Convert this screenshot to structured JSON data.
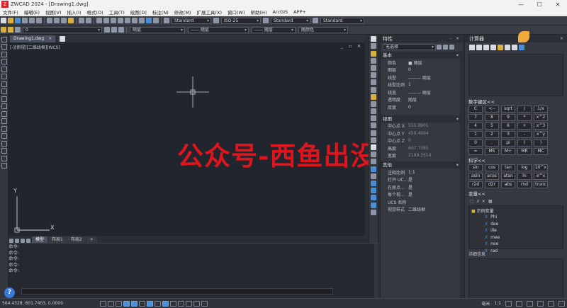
{
  "titlebar": {
    "logo": "Z",
    "title": "ZWCAD 2024 - [Drawing1.dwg]",
    "minimize": "—",
    "maximize": "☐",
    "close": "✕"
  },
  "menu": [
    "文件(F)",
    "编辑(E)",
    "视图(V)",
    "插入(I)",
    "格式(O)",
    "工具(T)",
    "绘图(D)",
    "标注(N)",
    "修改(M)",
    "扩展工具(X)",
    "窗口(W)",
    "帮助(H)",
    "ArcGIS",
    "APP+"
  ],
  "toolbar1": {
    "text_style": "Standard",
    "dim_style": "ISO-25",
    "table_style": "Standard",
    "multileader_style": "Standard"
  },
  "toolbar2": {
    "layer": "0",
    "color": "随层",
    "linetype": "—— 随层",
    "lineweight": "—— 随层",
    "plotstyle": "随颜色"
  },
  "doc": {
    "tab_label": "Drawing1.dwg",
    "viewport_label": "[-][俯视][二维线框][WCS]",
    "viewport_controls": "_ ▫ ✕"
  },
  "ucs": {
    "y": "Y",
    "x": "X"
  },
  "watermark": "公众号-西鱼出没",
  "layout_tabs": [
    "模型",
    "布局1",
    "布局2",
    "+"
  ],
  "command": {
    "lines": [
      "命令:",
      "命令:",
      "命令:",
      "命令:",
      "命令:"
    ]
  },
  "status": {
    "coords": "564.4328, 601.7403, 0.0000",
    "scale": "1:1",
    "units": "毫米"
  },
  "properties": {
    "title": "特性",
    "selection": "无选择",
    "sections": [
      {
        "name": "基本",
        "rows": [
          {
            "k": "颜色",
            "v": "■ 随层"
          },
          {
            "k": "图层",
            "v": "0"
          },
          {
            "k": "线型",
            "v": "——— 随层"
          },
          {
            "k": "线型比例",
            "v": "1"
          },
          {
            "k": "线宽",
            "v": "——— 随层"
          },
          {
            "k": "透明度",
            "v": "随层"
          },
          {
            "k": "厚度",
            "v": "0"
          }
        ]
      },
      {
        "name": "视图",
        "rows": [
          {
            "k": "中心点 X",
            "v": "555.8901"
          },
          {
            "k": "中心点 Y",
            "v": "450.4994"
          },
          {
            "k": "中心点 Z",
            "v": "0"
          },
          {
            "k": "高度",
            "v": "607.7385"
          },
          {
            "k": "宽度",
            "v": "2198.2614"
          }
        ]
      },
      {
        "name": "其他",
        "rows": [
          {
            "k": "注释比例",
            "v": "1:1"
          },
          {
            "k": "打开 UC...",
            "v": "是"
          },
          {
            "k": "在原点...",
            "v": "是"
          },
          {
            "k": "每个视...",
            "v": "是"
          },
          {
            "k": "UCS 名称",
            "v": ""
          },
          {
            "k": "视觉样式",
            "v": "二维线框"
          }
        ]
      }
    ]
  },
  "calculator": {
    "title": "计算器",
    "numpad_title": "数字键区<<",
    "numpad": [
      "C",
      "<--",
      "sqrt",
      "/",
      "1/x",
      "7",
      "8",
      "9",
      "*",
      "x^2",
      "4",
      "5",
      "6",
      "+",
      "x^3",
      "1",
      "2",
      "3",
      "-",
      "x^y",
      "0",
      ".",
      "pi",
      "(",
      ")",
      "=",
      "MS",
      "M+",
      "MR",
      "MC"
    ],
    "sci_title": "科学<<",
    "sci": [
      "sin",
      "cos",
      "tan",
      "log",
      "10^x",
      "asin",
      "acos",
      "atan",
      "ln",
      "e^x",
      "r2d",
      "d2r",
      "abs",
      "rnd",
      "trunc"
    ],
    "vars_title": "变量<<",
    "vars_folder": "示例变量",
    "vars": [
      "Phi",
      "dee",
      "ille",
      "mee",
      "nee",
      "rad"
    ],
    "detail_title": "详细信息"
  }
}
